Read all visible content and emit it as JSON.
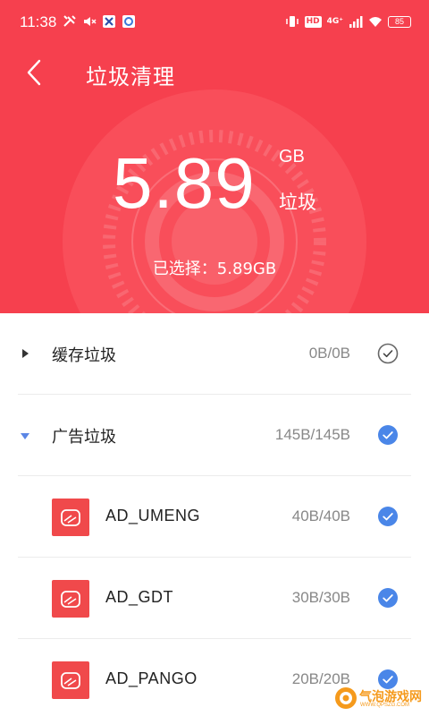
{
  "status_bar": {
    "time": "11:38",
    "hd_badge": "HD",
    "network": "4G⁺",
    "battery": "85"
  },
  "header": {
    "title": "垃圾清理"
  },
  "summary": {
    "amount": "5.89",
    "unit": "GB",
    "label": "垃圾",
    "selected": "已选择：5.89GB"
  },
  "categories": [
    {
      "label": "缓存垃圾",
      "size": "0B/0B",
      "expanded": false,
      "checked": false
    },
    {
      "label": "广告垃圾",
      "size": "145B/145B",
      "expanded": true,
      "checked": true
    }
  ],
  "ad_items": [
    {
      "label": "AD_UMENG",
      "size": "40B/40B",
      "checked": true
    },
    {
      "label": "AD_GDT",
      "size": "30B/30B",
      "checked": true
    },
    {
      "label": "AD_PANGO",
      "size": "20B/20B",
      "checked": true
    }
  ],
  "watermark": {
    "title": "气泡游戏网",
    "subtitle": "WWW.QPSZG.COM"
  },
  "colors": {
    "hero": "#f6404e",
    "check_blue": "#4a86e8",
    "app_icon": "#f0494b"
  }
}
